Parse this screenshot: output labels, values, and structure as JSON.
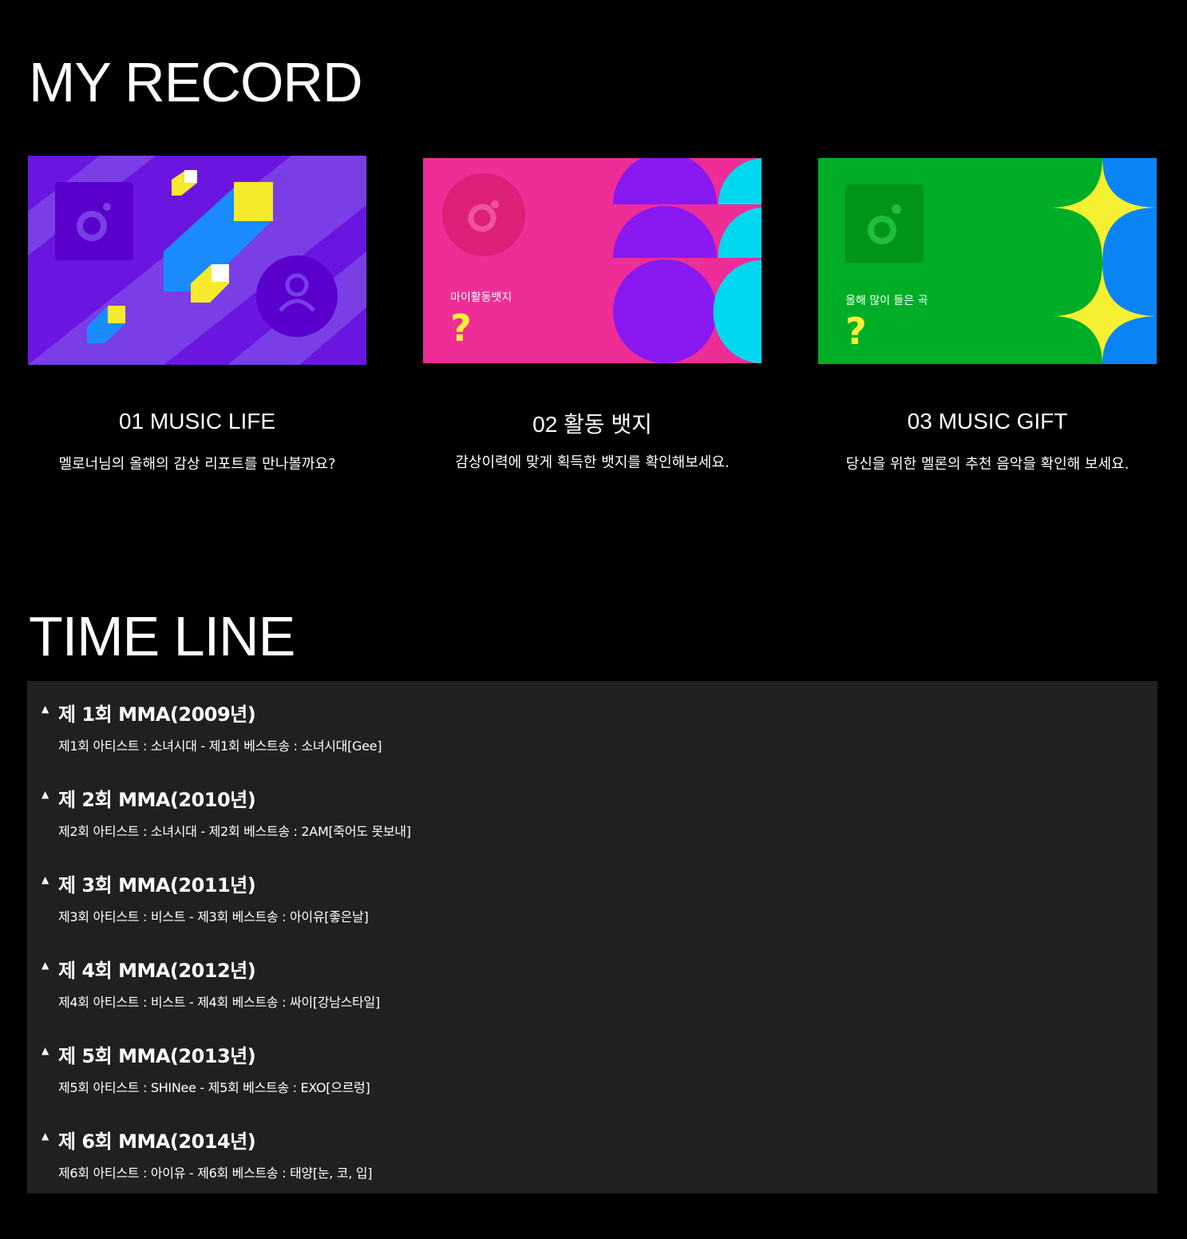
{
  "my_record": {
    "title": "MY RECORD",
    "cards": [
      {
        "title": "01 MUSIC LIFE",
        "desc": "멜로너님의 올해의 감상 리포트를 만나볼까요?",
        "overlay_label": "",
        "overlay_mark": "",
        "color": "#6a16e0"
      },
      {
        "title": "02 활동 뱃지",
        "desc": "감상이력에 맞게 획득한 뱃지를 확인해보세요.",
        "overlay_label": "마이활동뱃지",
        "overlay_mark": "?",
        "color": "#ee2d96"
      },
      {
        "title": "03 MUSIC GIFT",
        "desc": "당신을 위한 멜론의 추천 음악을 확인해 보세요.",
        "overlay_label": "올해 많이 들은 곡",
        "overlay_mark": "?",
        "color": "#00ad26"
      }
    ]
  },
  "timeline": {
    "title": "TIME LINE",
    "icon": "triangle-up-icon",
    "items": [
      {
        "heading": "제 1회 MMA(2009년)",
        "detail": "제1회 아티스트 : 소녀시대 - 제1회 베스트송 : 소녀시대[Gee]"
      },
      {
        "heading": "제 2회 MMA(2010년)",
        "detail": "제2회 아티스트 : 소녀시대 - 제2회 베스트송 : 2AM[죽어도 못보내]"
      },
      {
        "heading": "제 3회 MMA(2011년)",
        "detail": "제3회 아티스트 : 비스트 - 제3회 베스트송 : 아이유[좋은날]"
      },
      {
        "heading": "제 4회 MMA(2012년)",
        "detail": "제4회 아티스트 : 비스트 - 제4회 베스트송 : 싸이[강남스타일]"
      },
      {
        "heading": "제 5회 MMA(2013년)",
        "detail": "제5회 아티스트 : SHINee - 제5회 베스트송 : EXO[으르렁]"
      },
      {
        "heading": "제 6회 MMA(2014년)",
        "detail": "제6회 아티스트 : 아이유 - 제6회 베스트송 : 태양[눈, 코, 입]"
      }
    ]
  }
}
